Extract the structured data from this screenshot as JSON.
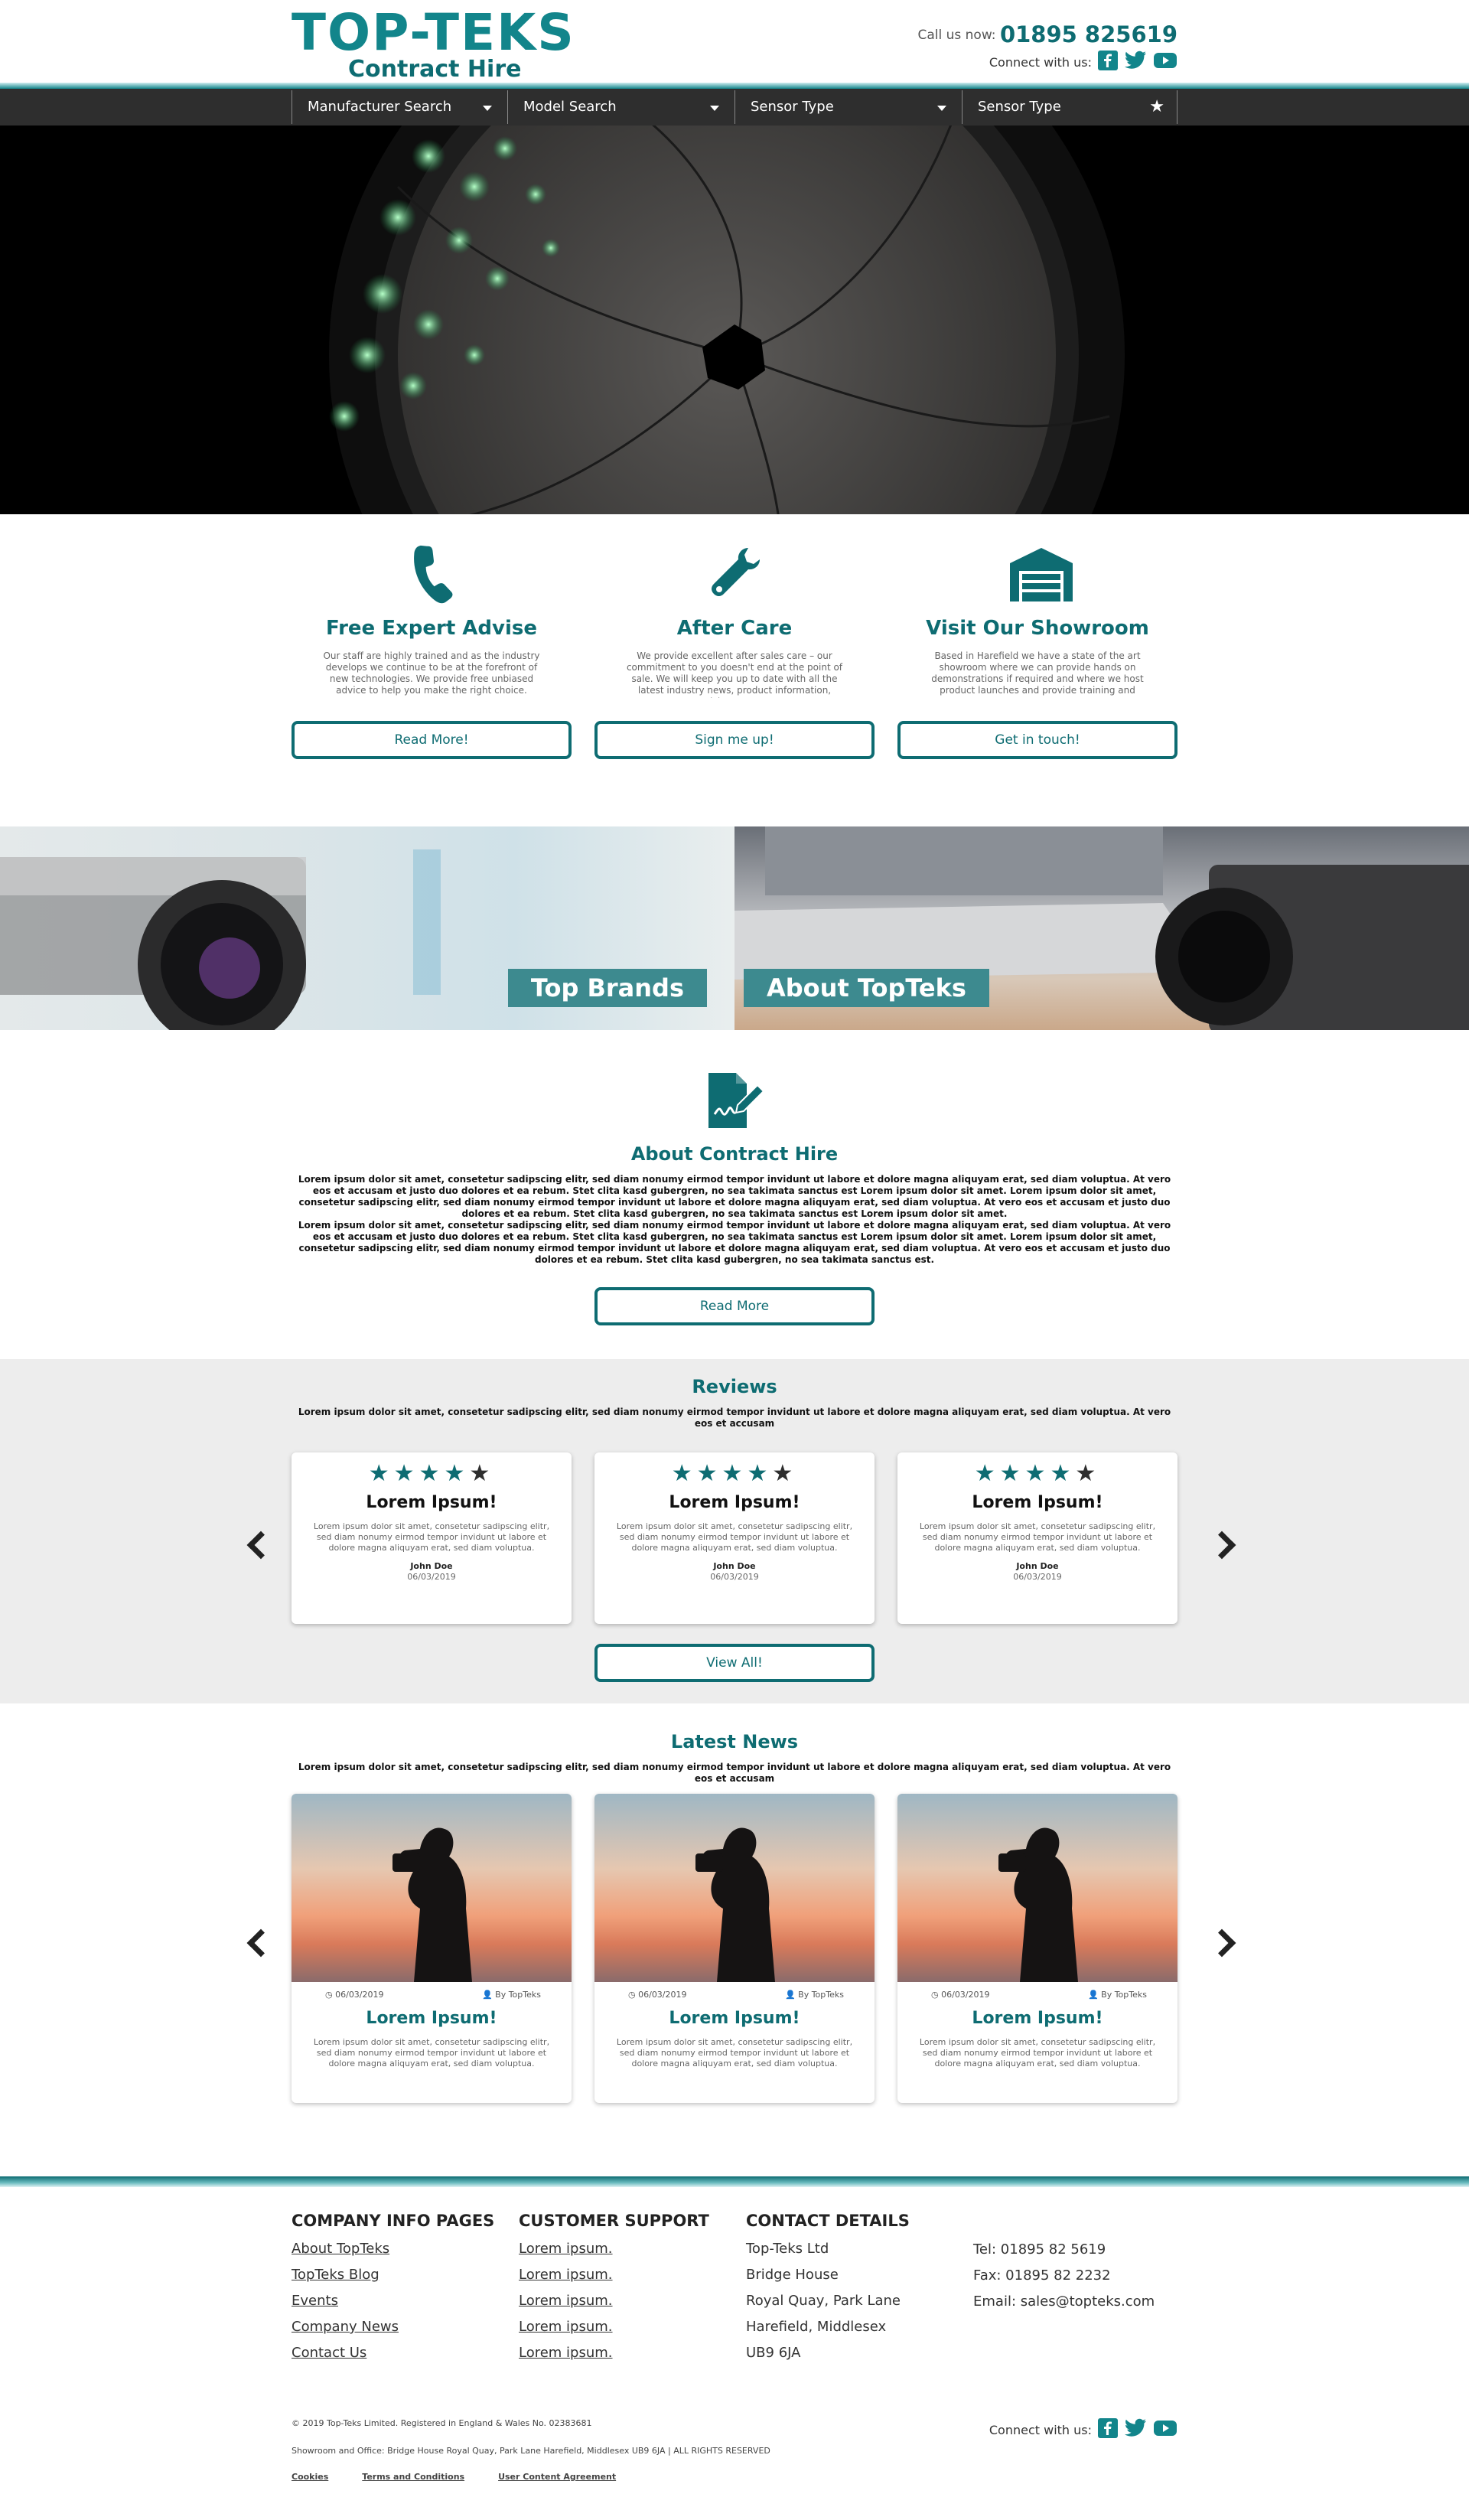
{
  "header": {
    "logo_top": "TOP-TEKS",
    "logo_bottom": "Contract Hire",
    "call_label": "Call us now:",
    "phone": "01895 825619",
    "connect_label": "Connect with us:"
  },
  "nav": [
    {
      "label": "Manufacturer Search",
      "icon": "caret-down-icon"
    },
    {
      "label": "Model Search",
      "icon": "caret-down-icon"
    },
    {
      "label": "Sensor Type",
      "icon": "caret-down-icon"
    },
    {
      "label": "Sensor Type",
      "icon": "star-icon"
    }
  ],
  "features": [
    {
      "icon": "phone-icon",
      "title": "Free Expert Advise",
      "text": "Our staff are highly trained and as the industry develops we continue to be at the forefront of new technologies. We provide free unbiased advice to help you make the right choice.",
      "button": "Read More!"
    },
    {
      "icon": "wrench-icon",
      "title": "After Care",
      "text": "We provide excellent after sales care – our commitment to you doesn't end at the point of sale. We will keep you up to date with all the latest industry news, product information, pricing, events",
      "button": "Sign me up!"
    },
    {
      "icon": "garage-icon",
      "title": "Visit Our Showroom",
      "text": "Based in Harefield we have a state of the art showroom where we can provide hands on demonstrations if required and where we host product launches and provide training and",
      "button": "Get in touch!"
    }
  ],
  "banners": {
    "left": "Top Brands",
    "right": "About TopTeks"
  },
  "about": {
    "title": "About Contract Hire",
    "paragraphs": [
      "Lorem ipsum dolor sit amet, consetetur sadipscing elitr, sed diam nonumy eirmod tempor invidunt ut labore et dolore magna aliquyam erat, sed diam voluptua. At vero eos et accusam et justo duo dolores et ea rebum. Stet clita kasd gubergren, no sea takimata sanctus est Lorem ipsum dolor sit amet. Lorem ipsum dolor sit amet, consetetur sadipscing elitr, sed diam nonumy eirmod tempor invidunt ut labore et dolore magna aliquyam erat, sed diam voluptua. At vero eos et accusam et justo duo dolores et ea rebum. Stet clita kasd gubergren, no sea takimata sanctus est Lorem ipsum dolor sit amet.",
      "Lorem ipsum dolor sit amet, consetetur sadipscing elitr, sed diam nonumy eirmod tempor invidunt ut labore et dolore magna aliquyam erat, sed diam voluptua. At vero eos et accusam et justo duo dolores et ea rebum. Stet clita kasd gubergren, no sea takimata sanctus est Lorem ipsum dolor sit amet. Lorem ipsum dolor sit amet, consetetur sadipscing elitr, sed diam nonumy eirmod tempor invidunt ut labore et dolore magna aliquyam erat, sed diam voluptua. At vero eos et accusam et justo duo dolores et ea rebum. Stet clita kasd gubergren, no sea takimata sanctus est."
    ],
    "button": "Read More"
  },
  "reviews": {
    "title": "Reviews",
    "intro": "Lorem ipsum dolor sit amet, consetetur sadipscing elitr, sed diam nonumy eirmod tempor invidunt ut labore et dolore magna aliquyam erat, sed diam voluptua. At vero eos et accusam",
    "items": [
      {
        "rating": 4,
        "title": "Lorem Ipsum!",
        "text": "Lorem ipsum dolor sit amet, consetetur sadipscing elitr, sed diam nonumy eirmod tempor invidunt ut labore et dolore magna aliquyam erat, sed diam voluptua.",
        "author": "John Doe",
        "date": "06/03/2019"
      },
      {
        "rating": 4,
        "title": "Lorem Ipsum!",
        "text": "Lorem ipsum dolor sit amet, consetetur sadipscing elitr, sed diam nonumy eirmod tempor invidunt ut labore et dolore magna aliquyam erat, sed diam voluptua.",
        "author": "John Doe",
        "date": "06/03/2019"
      },
      {
        "rating": 4,
        "title": "Lorem Ipsum!",
        "text": "Lorem ipsum dolor sit amet, consetetur sadipscing elitr, sed diam nonumy eirmod tempor invidunt ut labore et dolore magna aliquyam erat, sed diam voluptua.",
        "author": "John Doe",
        "date": "06/03/2019"
      }
    ],
    "button": "View All!"
  },
  "news": {
    "title": "Latest News",
    "intro": "Lorem ipsum dolor sit amet, consetetur sadipscing elitr, sed diam nonumy eirmod tempor invidunt ut labore et dolore magna aliquyam erat, sed diam voluptua. At vero eos et accusam",
    "items": [
      {
        "date": "06/03/2019",
        "author": "By TopTeks",
        "title": "Lorem Ipsum!",
        "text": "Lorem ipsum dolor sit amet, consetetur sadipscing elitr, sed diam nonumy eirmod tempor invidunt ut labore et dolore magna aliquyam erat, sed diam voluptua."
      },
      {
        "date": "06/03/2019",
        "author": "By TopTeks",
        "title": "Lorem Ipsum!",
        "text": "Lorem ipsum dolor sit amet, consetetur sadipscing elitr, sed diam nonumy eirmod tempor invidunt ut labore et dolore magna aliquyam erat, sed diam voluptua."
      },
      {
        "date": "06/03/2019",
        "author": "By TopTeks",
        "title": "Lorem Ipsum!",
        "text": "Lorem ipsum dolor sit amet, consetetur sadipscing elitr, sed diam nonumy eirmod tempor invidunt ut labore et dolore magna aliquyam erat, sed diam voluptua."
      }
    ]
  },
  "footer": {
    "col1": {
      "heading": "COMPANY INFO PAGES",
      "links": [
        "About TopTeks",
        "TopTeks Blog",
        "Events",
        "Company News",
        "Contact Us"
      ]
    },
    "col2": {
      "heading": "CUSTOMER SUPPORT",
      "links": [
        "Lorem ipsum.",
        "Lorem ipsum.",
        "Lorem ipsum.",
        "Lorem ipsum.",
        "Lorem ipsum."
      ]
    },
    "col3": {
      "heading": "CONTACT DETAILS",
      "lines": [
        "Top-Teks Ltd",
        "Bridge House",
        "Royal Quay, Park Lane",
        "Harefield, Middlesex",
        "UB9 6JA"
      ]
    },
    "col4": {
      "lines": [
        "Tel: 01895 82 5619",
        "Fax: 01895 82 2232",
        "Email: sales@topteks.com"
      ]
    },
    "copyright": "© 2019 Top-Teks Limited. Registered in England & Wales No. 02383681",
    "address": "Showroom and Office: Bridge House Royal Quay, Park Lane Harefield, Middlesex UB9 6JA | ALL RIGHTS RESERVED",
    "legal": [
      "Cookies",
      "Terms and Conditions",
      "User Content Agreement"
    ],
    "connect_label": "Connect with us:"
  },
  "colors": {
    "brand": "#12858b",
    "brand_dark": "#0e6c72",
    "nav_bg": "#2e2e2e",
    "section_grey": "#ededed"
  }
}
